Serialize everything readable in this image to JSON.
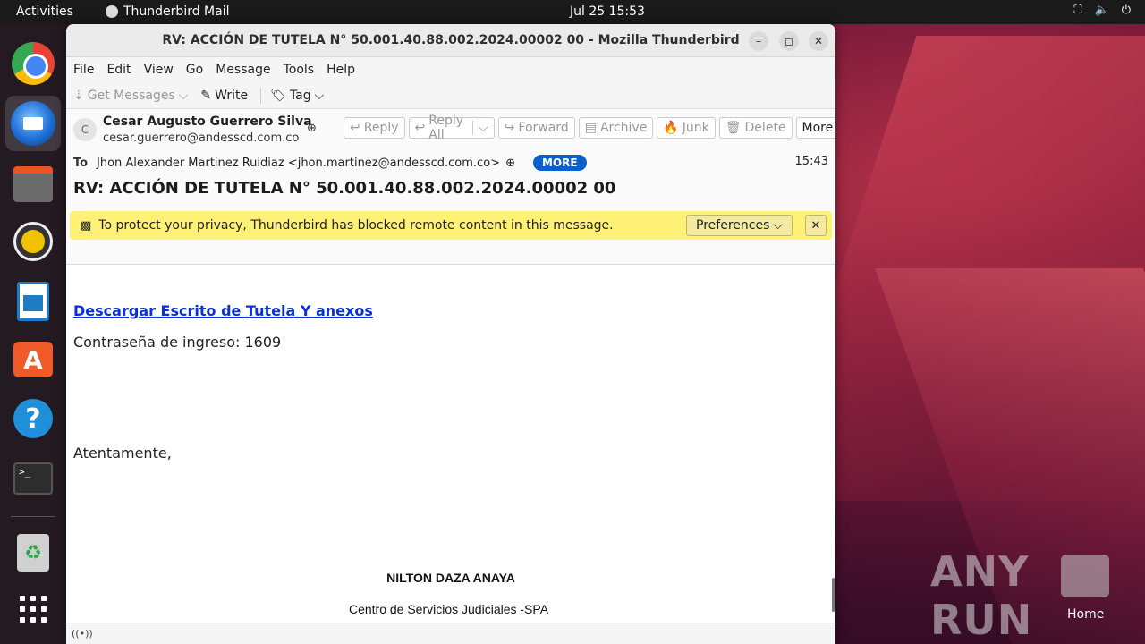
{
  "topbar": {
    "activities": "Activities",
    "app_name": "Thunderbird Mail",
    "clock": "Jul 25  15:53"
  },
  "dock": {
    "items": [
      "Google Chrome",
      "Thunderbird Mail",
      "Files",
      "Rhythmbox",
      "LibreOffice Writer",
      "Ubuntu Software",
      "Help",
      "Terminal",
      "Trash",
      "Show Applications"
    ]
  },
  "window": {
    "title": "RV: ACCIÓN DE TUTELA N° 50.001.40.88.002.2024.00002 00 - Mozilla Thunderbird"
  },
  "menu": {
    "file": "File",
    "edit": "Edit",
    "view": "View",
    "go": "Go",
    "message": "Message",
    "tools": "Tools",
    "help": "Help"
  },
  "toolbar": {
    "get_messages": "Get Messages",
    "write": "Write",
    "tag": "Tag"
  },
  "message": {
    "avatar_letter": "C",
    "sender_name": "Cesar Augusto Guerrero Silva",
    "sender_email": "cesar.guerrero@andesscd.com.co",
    "actions": {
      "reply": "Reply",
      "reply_all": "Reply All",
      "forward": "Forward",
      "archive": "Archive",
      "junk": "Junk",
      "delete": "Delete",
      "more": "More"
    },
    "to_label": "To",
    "to": "Jhon Alexander Martinez Ruidiaz <jhon.martinez@andesscd.com.co>",
    "more_badge": "MORE",
    "time": "15:43",
    "subject": "RV: ACCIÓN DE TUTELA N° 50.001.40.88.002.2024.00002 00",
    "privacy_text": "To protect your privacy, Thunderbird has blocked remote content in this message.",
    "preferences": "Preferences"
  },
  "body": {
    "link_text": "Descargar Escrito de Tutela Y anexos",
    "password_line": "Contraseña de ingreso: 1609",
    "regards": "Atentamente,",
    "sig_name": "NILTON DAZA ANAYA",
    "sig_org": "Centro de Servicios Judiciales -SPA"
  },
  "desktop": {
    "watermark": "ANY RUN",
    "home_label": "Home"
  }
}
